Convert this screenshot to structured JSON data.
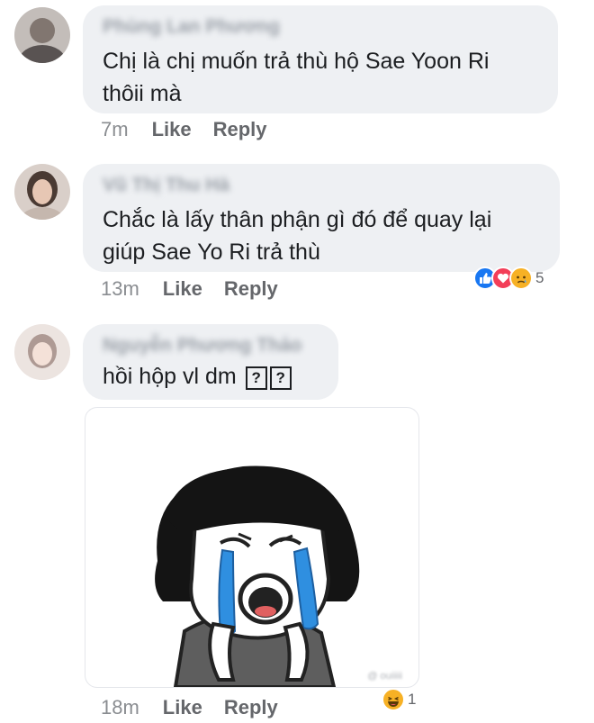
{
  "comments": [
    {
      "author": "Phùng Lan Phương",
      "text_lines": [
        "Chị là chị muốn trả thù hộ Sae Yoon Ri",
        "thôii mà"
      ],
      "time": "7m",
      "like_label": "Like",
      "reply_label": "Reply"
    },
    {
      "author": "Vũ Thị Thu Hà",
      "text_lines": [
        "Chắc là lấy thân phận gì đó để quay lại",
        "giúp Sae Yo Ri trả thù"
      ],
      "time": "13m",
      "like_label": "Like",
      "reply_label": "Reply",
      "reaction_count": "5"
    },
    {
      "author": "Nguyễn Phương Thảo",
      "text": "hồi hộp vl dm",
      "unknown_glyph": "?",
      "time": "18m",
      "like_label": "Like",
      "reply_label": "Reply",
      "reaction_count": "1",
      "sticker_watermark": "@ ouiiiii"
    }
  ],
  "icons": {
    "like": "thumbs-up-icon",
    "love": "heart-icon",
    "sad": "sad-face-icon",
    "haha": "laughing-face-icon"
  },
  "colors": {
    "bubble": "#eef0f3",
    "like_blue": "#1877f2",
    "love_red": "#f33e58",
    "emoji_yellow": "#f7b125",
    "meta_gray": "#65676b"
  }
}
